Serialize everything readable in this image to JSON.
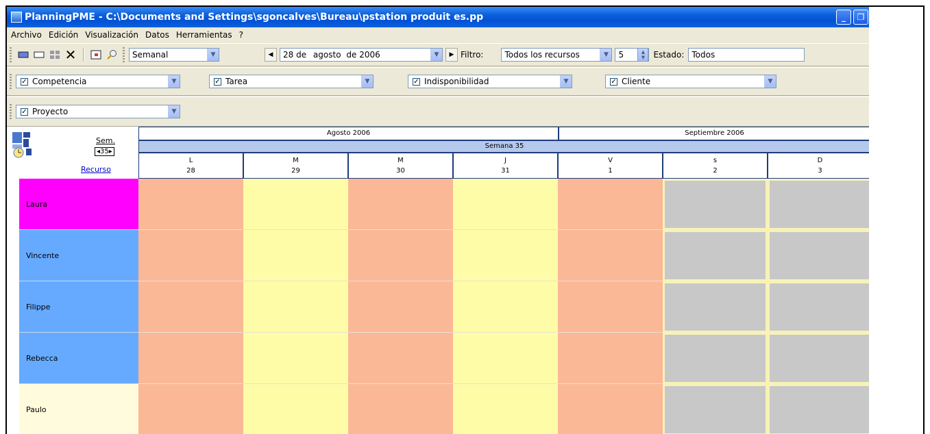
{
  "window": {
    "title": "PlanningPME - C:\\Documents and Settings\\sgoncalves\\Bureau\\pstation produit es.pp",
    "min_glyph": "_",
    "max_glyph": "❐"
  },
  "menu": [
    "Archivo",
    "Edición",
    "Visualización",
    "Datos",
    "Herramientas",
    "?"
  ],
  "toolbar1": {
    "view": "Semanal",
    "date_day": "28 de",
    "date_month": "agosto",
    "date_year": "de 2006",
    "filtro_label": "Filtro:",
    "filtro_value": "Todos los recursos",
    "count_value": "5",
    "estado_label": "Estado:",
    "estado_value": "Todos"
  },
  "toolbar2": {
    "competencia": "Competencia",
    "tarea": "Tarea",
    "indisponibilidad": "Indisponibilidad",
    "cliente": "Cliente"
  },
  "toolbar3": {
    "proyecto": "Proyecto"
  },
  "grid": {
    "sem_label": "Sem.",
    "sem_nav": "◂35▸",
    "recurso_label": "Recurso",
    "months": [
      "Agosto 2006",
      "Septiembre 2006"
    ],
    "week": "Semana 35",
    "days": [
      {
        "letter": "L",
        "num": "28"
      },
      {
        "letter": "M",
        "num": "29"
      },
      {
        "letter": "M",
        "num": "30"
      },
      {
        "letter": "J",
        "num": "31"
      },
      {
        "letter": "V",
        "num": "1"
      },
      {
        "letter": "s",
        "num": "2"
      },
      {
        "letter": "D",
        "num": "3"
      }
    ],
    "resources": [
      {
        "name": "Laura",
        "color": "#ff00ff"
      },
      {
        "name": "Vincente",
        "color": "#66aaff"
      },
      {
        "name": "Filippe",
        "color": "#66aaff"
      },
      {
        "name": "Rebecca",
        "color": "#66aaff"
      },
      {
        "name": "Paulo",
        "color": "#fffbdc"
      }
    ],
    "colors": {
      "workday_a": "#fbb896",
      "workday_b": "#fffca8",
      "weekend": "#c8c8c8"
    }
  }
}
